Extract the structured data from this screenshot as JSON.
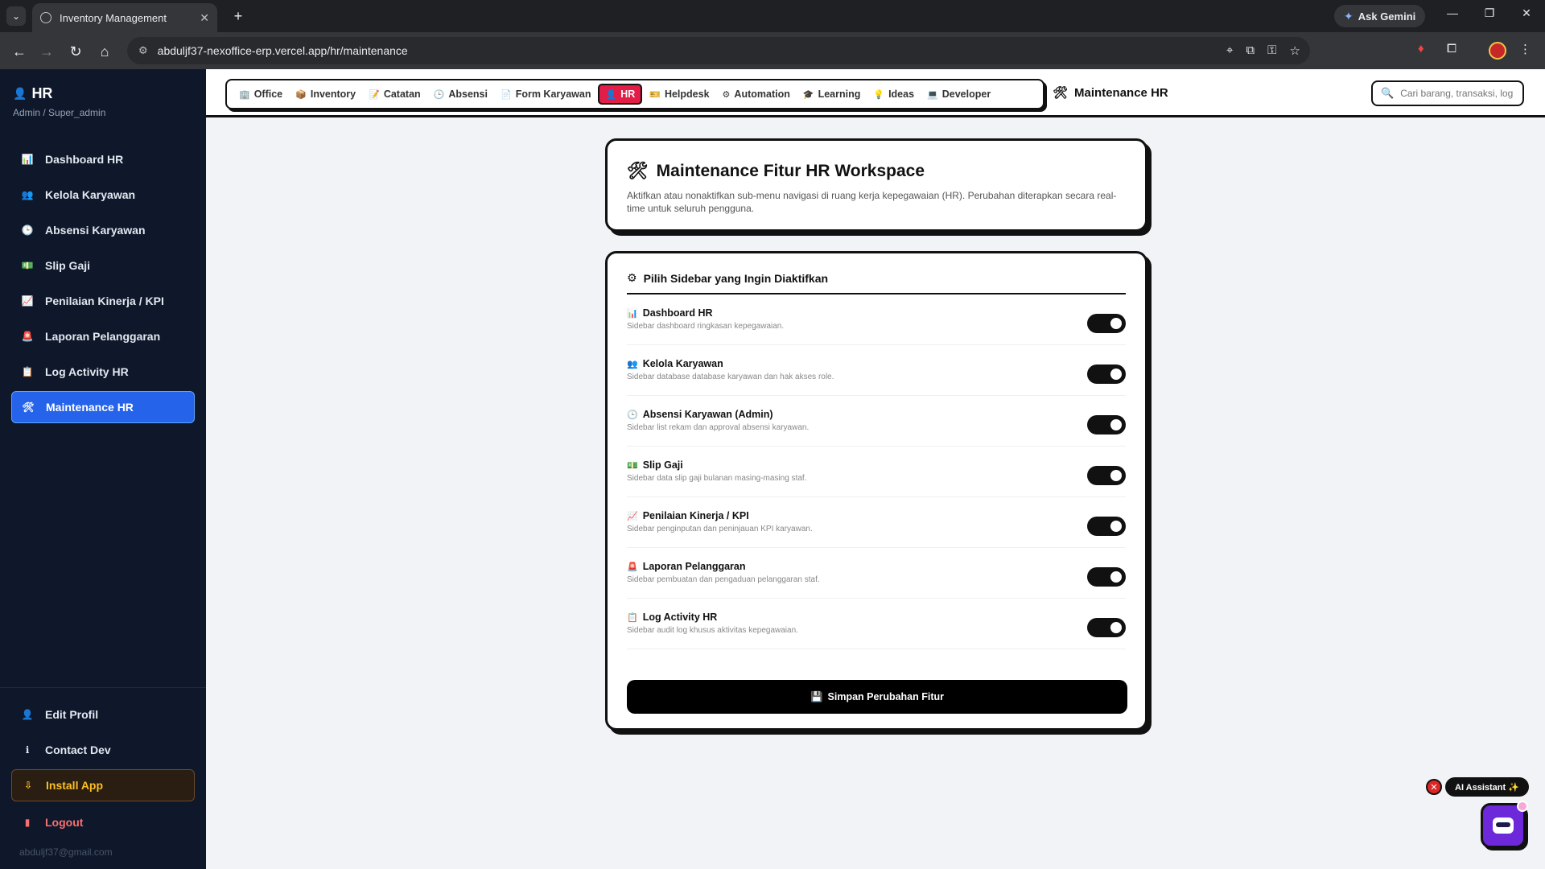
{
  "browser": {
    "tab_title": "Inventory Management",
    "url": "abduljf37-nexoffice-erp.vercel.app/hr/maintenance",
    "gemini_label": "Ask Gemini"
  },
  "sidebar": {
    "title": "HR",
    "role": "Admin / Super_admin",
    "items": [
      {
        "label": "Dashboard HR",
        "icon": "📊"
      },
      {
        "label": "Kelola Karyawan",
        "icon": "👥"
      },
      {
        "label": "Absensi Karyawan",
        "icon": "🕒"
      },
      {
        "label": "Slip Gaji",
        "icon": "💵"
      },
      {
        "label": "Penilaian Kinerja / KPI",
        "icon": "📈"
      },
      {
        "label": "Laporan Pelanggaran",
        "icon": "🚨"
      },
      {
        "label": "Log Activity HR",
        "icon": "📋"
      },
      {
        "label": "Maintenance HR",
        "icon": "🛠"
      }
    ],
    "bottom": {
      "edit_profile": "Edit Profil",
      "contact_dev": "Contact Dev",
      "install_app": "Install App",
      "logout": "Logout",
      "email": "abduljf37@gmail.com"
    }
  },
  "topnav": {
    "links": [
      {
        "label": "Office",
        "icon": "🏢"
      },
      {
        "label": "Inventory",
        "icon": "📦"
      },
      {
        "label": "Catatan",
        "icon": "📝"
      },
      {
        "label": "Absensi",
        "icon": "🕒"
      },
      {
        "label": "Form Karyawan",
        "icon": "📄"
      },
      {
        "label": "HR",
        "icon": "👤"
      },
      {
        "label": "Helpdesk",
        "icon": "🎫"
      },
      {
        "label": "Automation",
        "icon": "⚙"
      },
      {
        "label": "Learning",
        "icon": "🎓"
      },
      {
        "label": "Ideas",
        "icon": "💡"
      },
      {
        "label": "Developer",
        "icon": "💻"
      }
    ],
    "current_page": "Maintenance HR",
    "search_placeholder": "Cari barang, transaksi, log..."
  },
  "header_card": {
    "title": "Maintenance Fitur HR Workspace",
    "description": "Aktifkan atau nonaktifkan sub-menu navigasi di ruang kerja kepegawaian (HR). Perubahan diterapkan secara real-time untuk seluruh pengguna."
  },
  "features_card": {
    "title": "Pilih Sidebar yang Ingin Diaktifkan",
    "features": [
      {
        "name": "Dashboard HR",
        "icon": "📊",
        "desc": "Sidebar dashboard ringkasan kepegawaian.",
        "enabled": true
      },
      {
        "name": "Kelola Karyawan",
        "icon": "👥",
        "desc": "Sidebar database database karyawan dan hak akses role.",
        "enabled": true
      },
      {
        "name": "Absensi Karyawan (Admin)",
        "icon": "🕒",
        "desc": "Sidebar list rekam dan approval absensi karyawan.",
        "enabled": true
      },
      {
        "name": "Slip Gaji",
        "icon": "💵",
        "desc": "Sidebar data slip gaji bulanan masing-masing staf.",
        "enabled": true
      },
      {
        "name": "Penilaian Kinerja / KPI",
        "icon": "📈",
        "desc": "Sidebar penginputan dan peninjauan KPI karyawan.",
        "enabled": true
      },
      {
        "name": "Laporan Pelanggaran",
        "icon": "🚨",
        "desc": "Sidebar pembuatan dan pengaduan pelanggaran staf.",
        "enabled": true
      },
      {
        "name": "Log Activity HR",
        "icon": "📋",
        "desc": "Sidebar audit log khusus aktivitas kepegawaian.",
        "enabled": true
      }
    ],
    "save_label": "Simpan Perubahan Fitur"
  },
  "ai_assistant": {
    "label": "AI Assistant ✨"
  }
}
